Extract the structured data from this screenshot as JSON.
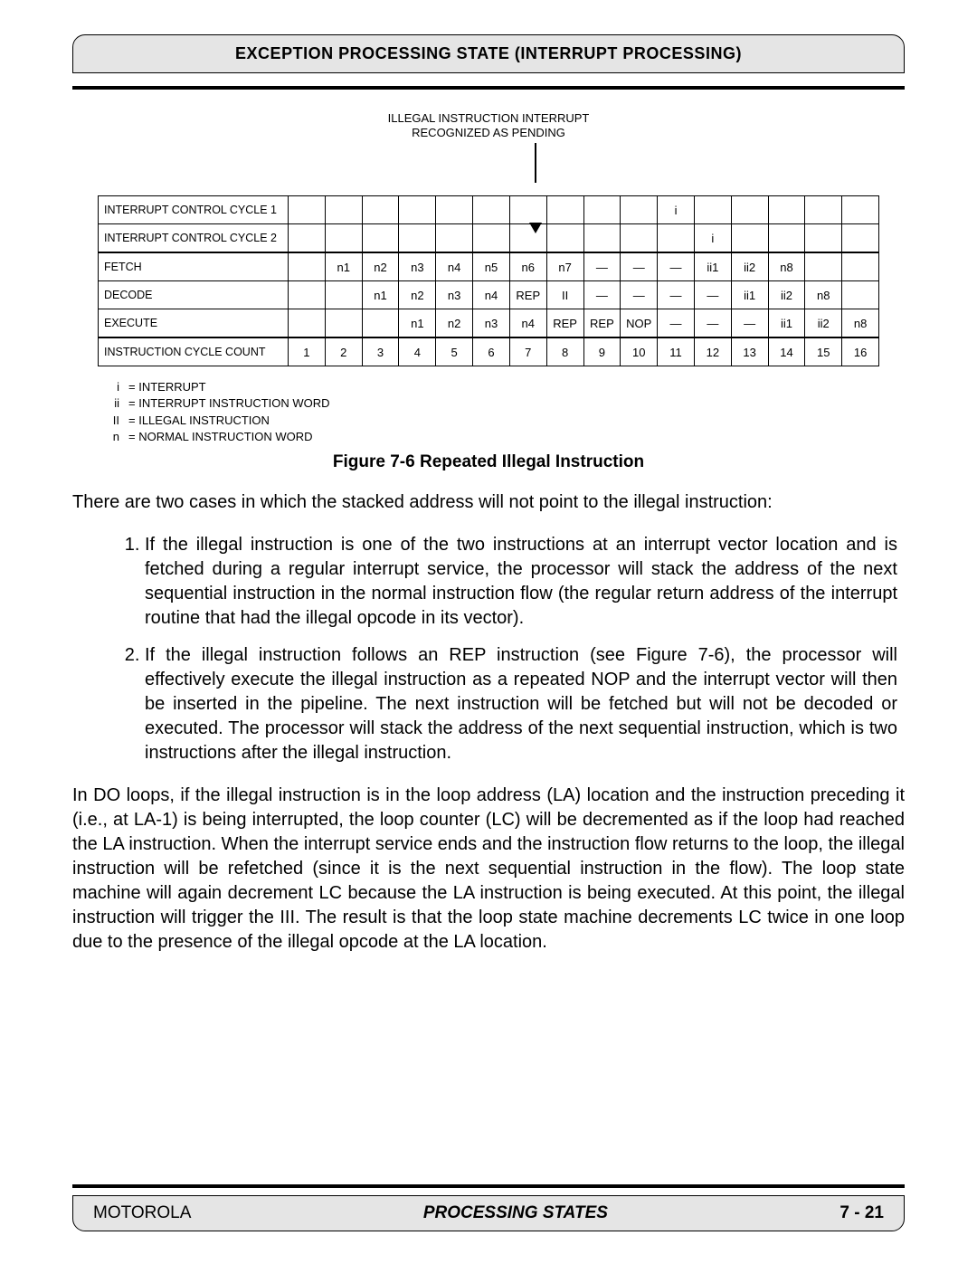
{
  "header": "EXCEPTION PROCESSING STATE (INTERRUPT PROCESSING)",
  "annotation": {
    "line1": "ILLEGAL INSTRUCTION INTERRUPT",
    "line2": "RECOGNIZED AS PENDING"
  },
  "table": {
    "rows": [
      {
        "label": "INTERRUPT CONTROL CYCLE 1",
        "cells": [
          "",
          "",
          "",
          "",
          "",
          "",
          "",
          "",
          "",
          "",
          "i",
          "",
          "",
          "",
          "",
          ""
        ],
        "thick": false
      },
      {
        "label": "INTERRUPT CONTROL CYCLE 2",
        "cells": [
          "",
          "",
          "",
          "",
          "",
          "",
          "",
          "",
          "",
          "",
          "",
          "i",
          "",
          "",
          "",
          ""
        ],
        "thick": false
      },
      {
        "label": "FETCH",
        "cells": [
          "",
          "n1",
          "n2",
          "n3",
          "n4",
          "n5",
          "n6",
          "n7",
          "—",
          "—",
          "—",
          "ii1",
          "ii2",
          "n8",
          "",
          ""
        ],
        "thick": true
      },
      {
        "label": "DECODE",
        "cells": [
          "",
          "",
          "n1",
          "n2",
          "n3",
          "n4",
          "REP",
          "II",
          "—",
          "—",
          "—",
          "—",
          "ii1",
          "ii2",
          "n8",
          ""
        ],
        "thick": false
      },
      {
        "label": "EXECUTE",
        "cells": [
          "",
          "",
          "",
          "n1",
          "n2",
          "n3",
          "n4",
          "REP",
          "REP",
          "NOP",
          "—",
          "—",
          "—",
          "ii1",
          "ii2",
          "n8"
        ],
        "thick": false
      },
      {
        "label": "INSTRUCTION CYCLE COUNT",
        "cells": [
          "1",
          "2",
          "3",
          "4",
          "5",
          "6",
          "7",
          "8",
          "9",
          "10",
          "11",
          "12",
          "13",
          "14",
          "15",
          "16"
        ],
        "thick": true
      }
    ]
  },
  "legend": [
    {
      "sym": "i",
      "desc": "= INTERRUPT"
    },
    {
      "sym": "ii",
      "desc": "= INTERRUPT INSTRUCTION WORD"
    },
    {
      "sym": "II",
      "desc": "= ILLEGAL INSTRUCTION"
    },
    {
      "sym": "n",
      "desc": "= NORMAL INSTRUCTION WORD"
    }
  ],
  "figure_caption": "Figure  7-6  Repeated Illegal Instruction",
  "para_intro": "There are two cases in which the stacked address will not point to the illegal instruction:",
  "list": [
    "If the illegal instruction is one of the two instructions at an interrupt vector location and is fetched during a regular interrupt service, the processor will stack the address of the next sequential instruction in the normal instruction flow (the regular return address of the interrupt routine that had the illegal opcode in its vector).",
    "If the illegal instruction follows an REP instruction (see Figure 7-6), the processor will effectively execute the illegal instruction as a repeated NOP and the interrupt vector will then be inserted in the pipeline. The next instruction will be fetched but will not be decoded or executed. The processor will stack the address of the next sequential instruction, which is two instructions after the illegal instruction."
  ],
  "para_after": "In DO loops, if the illegal instruction is in the loop address (LA) location and the instruction preceding it (i.e., at LA-1) is being interrupted, the loop counter (LC) will be decremented as if the loop had reached the LA instruction. When the interrupt service ends and the instruction flow returns to the loop, the illegal instruction will be refetched (since it is the next sequential instruction in the flow). The loop state machine will again decrement LC because the LA instruction is being executed. At this point, the illegal instruction will trigger the III. The result is that the loop state machine decrements LC twice in one loop due to the presence of the illegal opcode at the LA location.",
  "footer": {
    "left": "MOTOROLA",
    "center": "PROCESSING STATES",
    "right": "7 - 21"
  }
}
